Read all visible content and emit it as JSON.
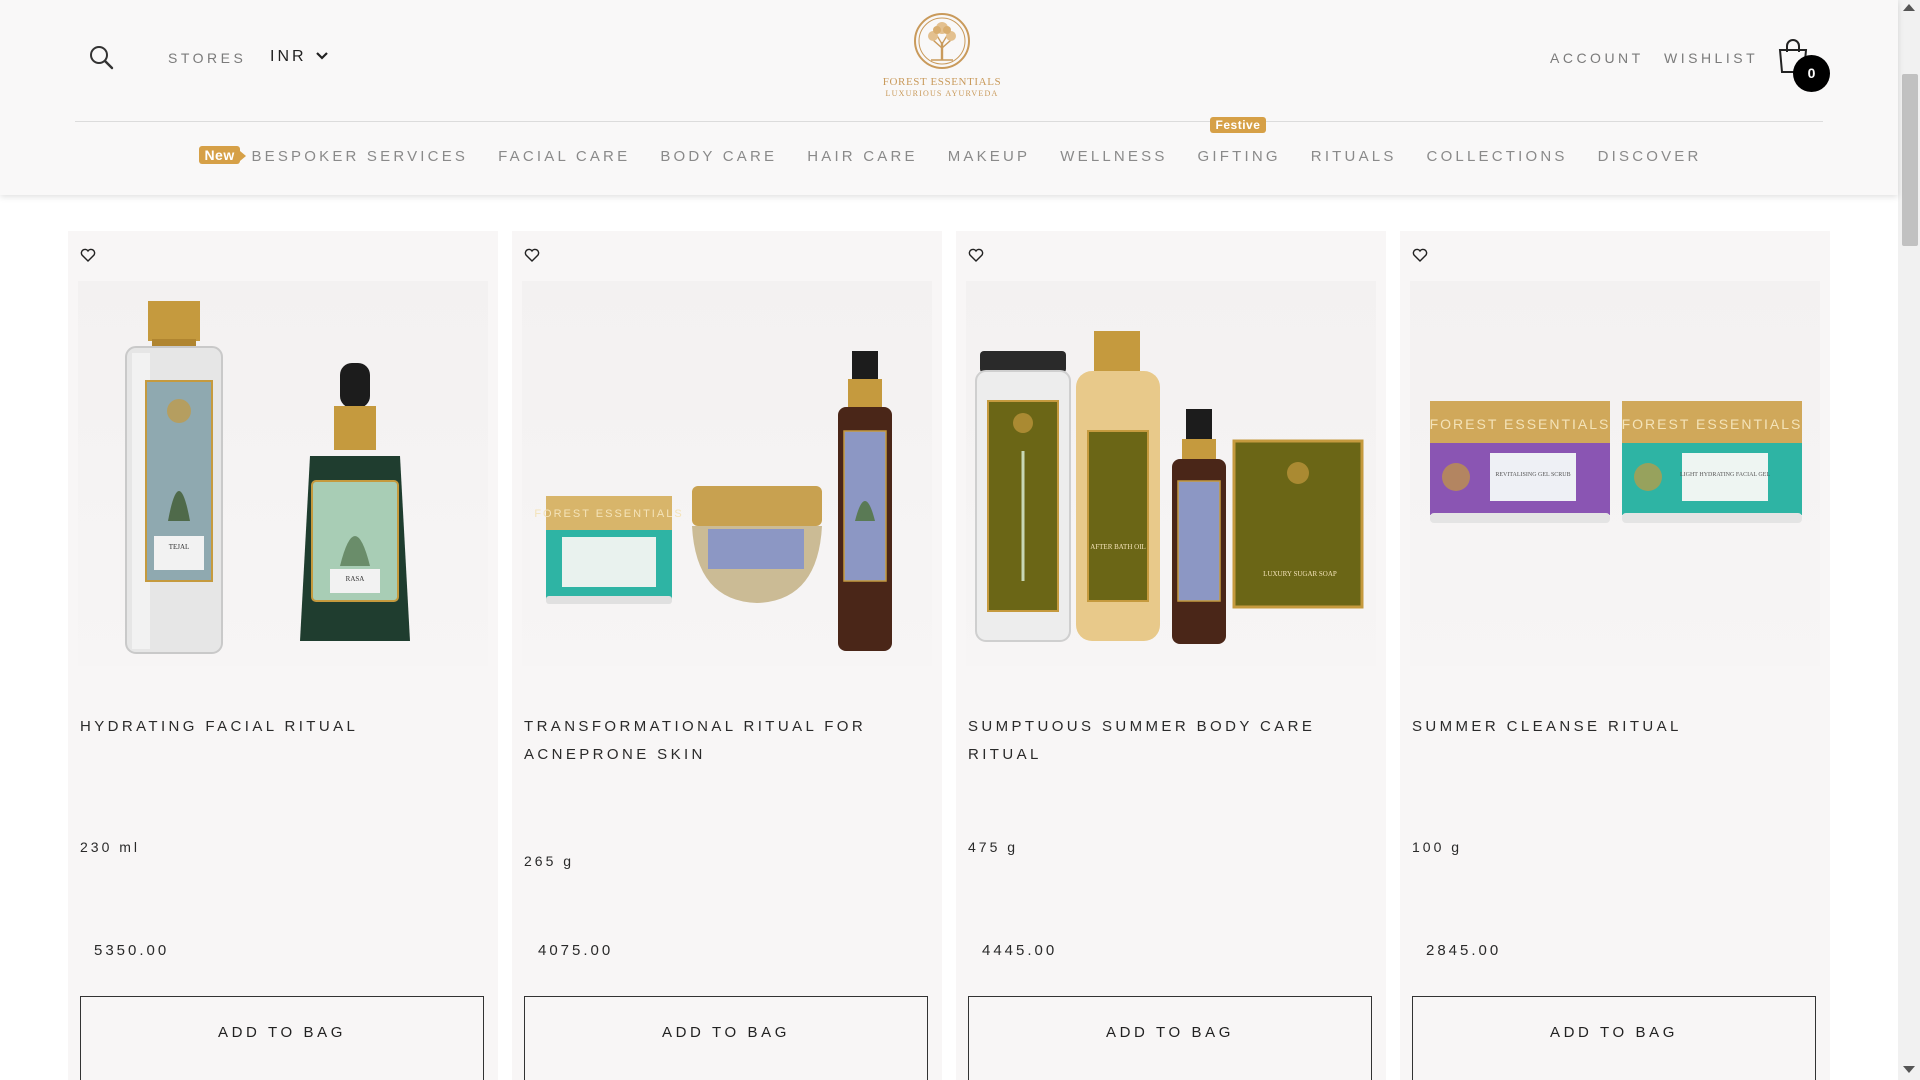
{
  "header": {
    "stores_label": "STORES",
    "currency": "INR",
    "logo_name": "FOREST ESSENTIALS",
    "logo_tag": "LUXURIOUS AYURVEDA",
    "account_label": "ACCOUNT",
    "wishlist_label": "WISHLIST",
    "cart_count": "0",
    "icons": [
      "search-icon",
      "chevron-down-icon",
      "tree-logo",
      "shopping-bag-icon"
    ]
  },
  "nav": {
    "new_badge": "New",
    "festive_badge": "Festive",
    "items": [
      "BESPOKER SERVICES",
      "FACIAL CARE",
      "BODY CARE",
      "HAIR CARE",
      "MAKEUP",
      "WELLNESS",
      "GIFTING",
      "RITUALS",
      "COLLECTIONS",
      "DISCOVER"
    ]
  },
  "colors": {
    "accent_gold": "#d6a047",
    "logo_gold": "#c99a5b",
    "header_bg": "#f9f8f8",
    "card_bg": "#f8f6f6"
  },
  "products": [
    {
      "title": "HYDRATING FACIAL RITUAL",
      "size": "230 ml",
      "price": "5350.00",
      "button": "ADD TO BAG",
      "wishlist_icon": "heart-outline-icon"
    },
    {
      "title": "TRANSFORMATIONAL RITUAL FOR ACNEPRONE SKIN",
      "size": "265 g",
      "price": "4075.00",
      "button": "ADD TO BAG",
      "wishlist_icon": "heart-outline-icon"
    },
    {
      "title": "SUMPTUOUS SUMMER BODY CARE RITUAL",
      "size": "475 g",
      "price": "4445.00",
      "button": "ADD TO BAG",
      "wishlist_icon": "heart-outline-icon"
    },
    {
      "title": "SUMMER CLEANSE RITUAL",
      "size": "100 g",
      "price": "2845.00",
      "button": "ADD TO BAG",
      "wishlist_icon": "heart-outline-icon"
    }
  ],
  "product_labels": [
    [
      "TEJAL",
      "RASA"
    ],
    [
      "FOREST ESSENTIALS"
    ],
    [
      "AFTER BATH OIL",
      "LUXURY SUGAR SOAP"
    ],
    [
      "FOREST ESSENTIALS",
      "FOREST ESSENTIALS",
      "REVITALISING GEL SCRUB",
      "LIGHT HYDRATING FACIAL GEL"
    ]
  ]
}
